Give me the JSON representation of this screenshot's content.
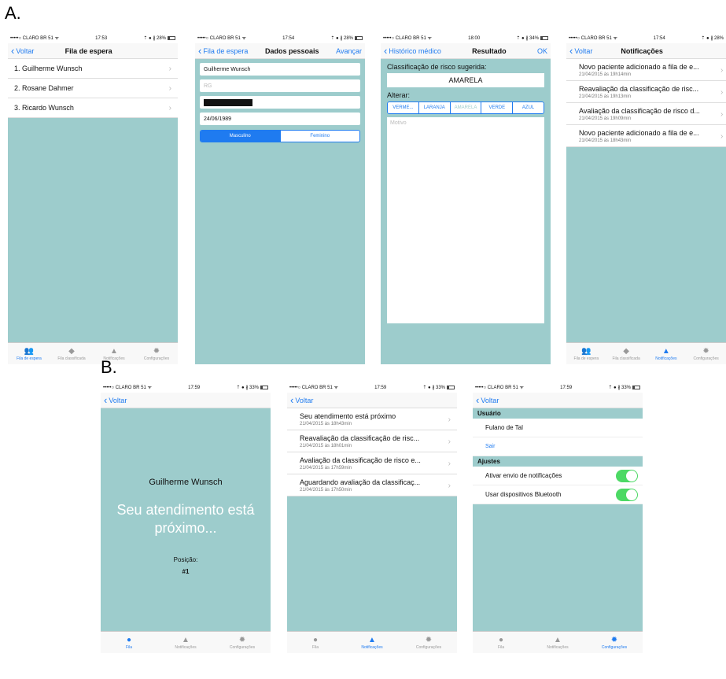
{
  "labels": {
    "a": "A.",
    "b": "B."
  },
  "status": {
    "carrier": "•••••○ CLARO BR 51 ᯤ",
    "a1": {
      "time": "17:53",
      "right": "⇡ ● ∦ 28%"
    },
    "a2": {
      "time": "17:54",
      "right": "⇡ ● ∦ 28%"
    },
    "a3": {
      "time": "18:00",
      "right": "⇡ ● ∦ 34%"
    },
    "a4": {
      "time": "17:54",
      "right": "⇡ ● ∦ 28%"
    },
    "b": {
      "time": "17:59",
      "right": "⇡ ● ∦ 33%"
    }
  },
  "screenA1": {
    "back": "Voltar",
    "title": "Fila de espera",
    "rows": [
      "1. Guilherme Wunsch",
      "2. Rosane Dahmer",
      "3. Ricardo Wunsch"
    ]
  },
  "screenA2": {
    "back": "Fila de espera",
    "title": "Dados pessoais",
    "action": "Avançar",
    "name": "Guilherme Wunsch",
    "rg_placeholder": "RG",
    "birthdate": "24/06/1989",
    "gender_options": [
      "Masculino",
      "Feminino"
    ]
  },
  "screenA3": {
    "back": "Histórico médico",
    "title": "Resultado",
    "action": "OK",
    "suggested_label": "Classificação de risco sugerida:",
    "suggested_value": "AMARELA",
    "change_label": "Alterar:",
    "options": [
      "VERME...",
      "LARANJA",
      "AMARELA",
      "VERDE",
      "AZUL"
    ],
    "reason_placeholder": "Motivo"
  },
  "screenA4": {
    "back": "Voltar",
    "title": "Notificações",
    "items": [
      {
        "text": "Novo paciente adicionado a fila de e...",
        "date": "21/04/2015 às 19h14min"
      },
      {
        "text": "Reavaliação da classificação de risc...",
        "date": "21/04/2015 às 19h13min"
      },
      {
        "text": "Avaliação da classificação de risco d...",
        "date": "21/04/2015 às 19h09min"
      },
      {
        "text": "Novo paciente adicionado a fila de e...",
        "date": "21/04/2015 às 18h43min"
      }
    ]
  },
  "tabsA": [
    "Fila de espera",
    "Fila classificada",
    "Notificações",
    "Configurações"
  ],
  "screenB1": {
    "back": "Voltar",
    "name": "Guilherme Wunsch",
    "message": "Seu atendimento está próximo...",
    "position_label": "Posição:",
    "position_value": "#1"
  },
  "screenB2": {
    "back": "Voltar",
    "items": [
      {
        "text": "Seu atendimento está próximo",
        "date": "21/04/2015 às 18h43min"
      },
      {
        "text": "Reavaliação da classificação de risc...",
        "date": "21/04/2015 às 18h01min"
      },
      {
        "text": "Avaliação da classificação de risco e...",
        "date": "21/04/2015 às 17h59min"
      },
      {
        "text": "Aguardando avaliação da classificaç...",
        "date": "21/04/2015 às 17h50min"
      }
    ]
  },
  "screenB3": {
    "back": "Voltar",
    "section_user": "Usuário",
    "user_name": "Fulano de Tal",
    "logout": "Sair",
    "section_settings": "Ajustes",
    "notify_label": "Ativar envio de notificações",
    "bluetooth_label": "Usar dispositivos Bluetooth"
  },
  "tabsB": [
    "Fila",
    "Notificações",
    "Configurações"
  ]
}
